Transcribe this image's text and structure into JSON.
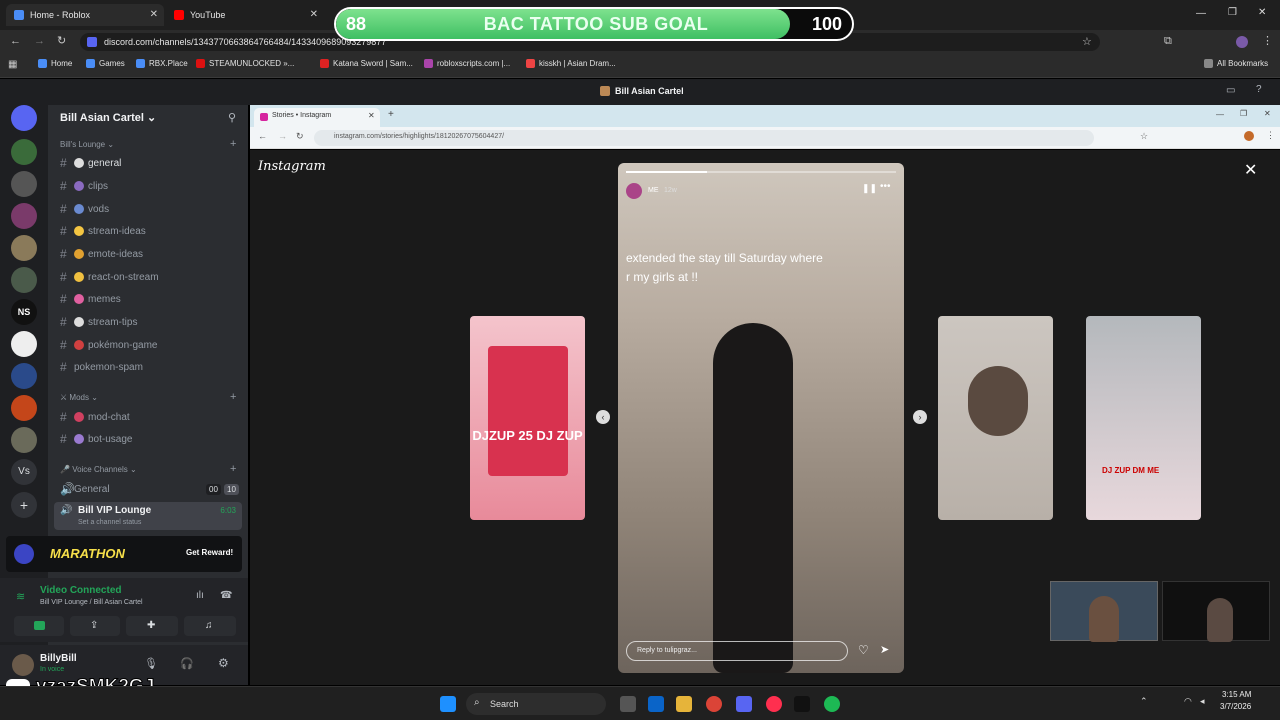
{
  "chrome": {
    "tabs": [
      {
        "label": "Home - Roblox"
      },
      {
        "label": "YouTube"
      }
    ],
    "url": "discord.com/channels/1343770663864766484/1433409689093279877",
    "bookmarks": [
      "Home",
      "Games",
      "RBX.Place",
      "STEAMUNLOCKED »...",
      "Katana Sword | Sam...",
      "robloxscripts.com |...",
      "kisskh | Asian Dram..."
    ],
    "all_bookmarks": "All Bookmarks"
  },
  "goal": {
    "left": "88",
    "right": "100",
    "title": "BAC TATTOO SUB GOAL",
    "progress": 0.88
  },
  "discord": {
    "window_title": "Bill Asian Cartel",
    "server_name": "Bill Asian Cartel",
    "category_lounge": "Bill's Lounge",
    "channels": [
      "general",
      "clips",
      "vods",
      "stream-ideas",
      "emote-ideas",
      "react-on-stream",
      "memes",
      "stream-tips",
      "pokémon-game",
      "pokemon-spam"
    ],
    "category_mods": "Mods",
    "mod_channels": [
      "mod-chat",
      "bot-usage"
    ],
    "category_voice": "Voice Channels",
    "voice_general": "General",
    "voice_general_counts": [
      "00",
      "10"
    ],
    "vip_lounge": "Bill VIP Lounge",
    "vip_time": "6:03",
    "vip_status": "Set a channel status",
    "marathon": "MARATHON",
    "get_reward": "Get Reward!",
    "video_connected": "Video Connected",
    "connected_location": "Bill VIP Lounge / Bill Asian Cartel",
    "username": "BillyBill",
    "user_status": "In voice",
    "rail_ns": "NS",
    "rail_vs": "Vs"
  },
  "inner_browser": {
    "tab_label": "Stories • Instagram",
    "url": "instagram.com/stories/highlights/18120267075604427/"
  },
  "instagram": {
    "logo": "Instagram",
    "story_user": "ME",
    "story_age": "12w",
    "story_text": "extended the stay till Saturday where r my girls at !!",
    "reply_placeholder": "Reply to tulipgraz...",
    "left_preview_text": "DJZUP 25 DJ ZUP",
    "right2_text": "DJ ZUP DM ME"
  },
  "watermark": "vzazSMK2GJ",
  "taskbar": {
    "search": "Search",
    "time": "3:15 AM",
    "date": "3/7/2026"
  }
}
